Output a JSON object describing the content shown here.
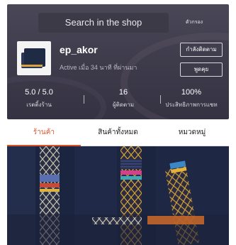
{
  "search": {
    "placeholder": "Search in the shop"
  },
  "top_link": "ตัวกรอง",
  "shop": {
    "name": "ep_akor",
    "active_status": "Active เมื่อ 34 นาที ที่ผ่านมา"
  },
  "buttons": {
    "follow": "กำลังติดตาม",
    "chat": "พูดคุย"
  },
  "stats": [
    {
      "value": "5.0 / 5.0",
      "label": "เรตติ้งร้าน"
    },
    {
      "value": "16",
      "label": "ผู้ติดตาม"
    },
    {
      "value": "100%",
      "label": "ประสิทธิภาพการแชท"
    }
  ],
  "tabs": [
    {
      "label": "ร้านค้า",
      "active": true
    },
    {
      "label": "สินค้าทั้งหมด",
      "active": false
    },
    {
      "label": "หมวดหมู่",
      "active": false
    }
  ],
  "colors": {
    "accent": "#d9542d",
    "header_bg": "#3d3a4a"
  }
}
